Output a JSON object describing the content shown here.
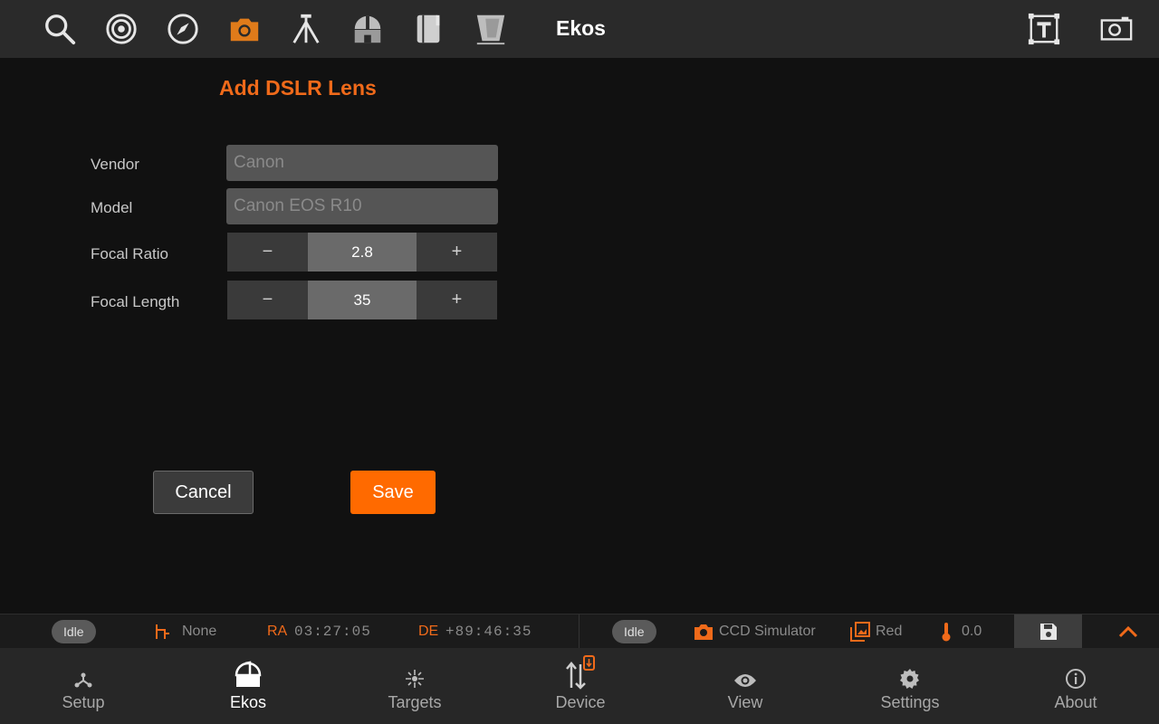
{
  "toolbar": {
    "title": "Ekos",
    "icons": [
      "search-icon",
      "target-icon",
      "compass-icon",
      "camera-icon",
      "tripod-icon",
      "observatory-icon",
      "logbook-icon",
      "telescope-icon",
      "text-box-icon",
      "screenshot-icon"
    ],
    "active_icon": "camera-icon",
    "accent_color": "#ff6a00"
  },
  "form": {
    "title": "Add DSLR Lens",
    "vendor_label": "Vendor",
    "vendor_placeholder": "Canon",
    "model_label": "Model",
    "model_placeholder": "Canon EOS R10",
    "focal_ratio_label": "Focal Ratio",
    "focal_ratio_value": "2.8",
    "focal_length_label": "Focal Length",
    "focal_length_value": "35",
    "minus": "−",
    "plus": "+",
    "cancel_label": "Cancel",
    "save_label": "Save"
  },
  "status": {
    "mount_state": "Idle",
    "mount_target": "None",
    "ra_label": "RA",
    "ra_value": "03:27:05",
    "de_label": "DE",
    "de_value": "+89:46:35",
    "camera_state": "Idle",
    "camera_name": "CCD Simulator",
    "filter": "Red",
    "temperature": "0.0"
  },
  "nav": {
    "items": [
      {
        "label": "Setup",
        "icon": "setup-icon"
      },
      {
        "label": "Ekos",
        "icon": "ekos-dome-icon"
      },
      {
        "label": "Targets",
        "icon": "targets-icon"
      },
      {
        "label": "Device",
        "icon": "device-icon"
      },
      {
        "label": "View",
        "icon": "eye-icon"
      },
      {
        "label": "Settings",
        "icon": "gear-icon"
      },
      {
        "label": "About",
        "icon": "info-icon"
      }
    ],
    "active": "Ekos"
  }
}
